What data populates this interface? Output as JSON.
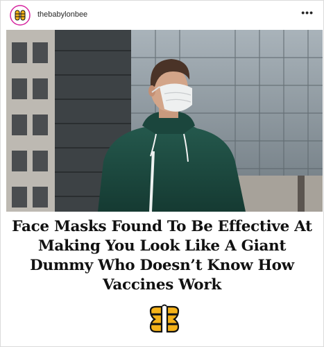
{
  "post": {
    "username": "thebabylonbee",
    "more_label": "•••",
    "headline_lines": [
      "Face Masks Found To Be Effective At",
      "Making You Look Like A Giant",
      "Dummy Who Doesn’t Know How",
      "Vaccines Work"
    ],
    "photo_description_icon": "man-with-face-mask-photo",
    "logo_icon": "babylon-bee-logo-icon"
  },
  "colors": {
    "bee_yellow": "#f5b21a",
    "jacket_green": "#1f4d43",
    "text": "#111111"
  }
}
